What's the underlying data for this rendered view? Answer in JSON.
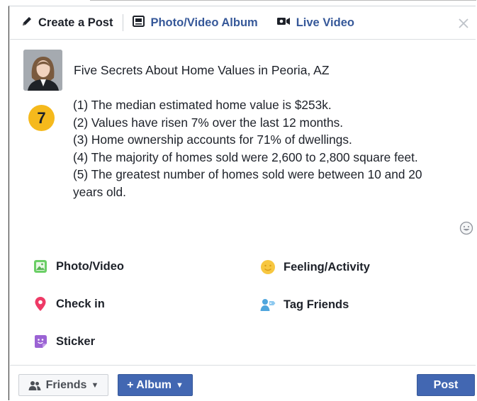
{
  "tabs": {
    "create_post": "Create a Post",
    "photo_album": "Photo/Video Album",
    "live_video": "Live Video"
  },
  "post": {
    "title": "Five Secrets About Home Values in Peoria, AZ",
    "badge_number": "7",
    "lines": [
      "(1) The median estimated home value is $253k.",
      "(2) Values have risen 7% over the last 12 months.",
      "(3) Home ownership accounts for 71% of dwellings.",
      "(4) The majority of homes sold were 2,600 to 2,800 square feet.",
      "(5) The greatest number of homes sold were between 10 and 20 years old."
    ]
  },
  "options": {
    "photo_video": "Photo/Video",
    "feeling_activity": "Feeling/Activity",
    "check_in": "Check in",
    "tag_friends": "Tag Friends",
    "sticker": "Sticker"
  },
  "footer": {
    "audience_label": "Friends",
    "album_label": "+ Album",
    "post_label": "Post"
  },
  "colors": {
    "brand_blue": "#4267b2",
    "link_blue": "#365899",
    "badge_yellow": "#f5b91c"
  }
}
